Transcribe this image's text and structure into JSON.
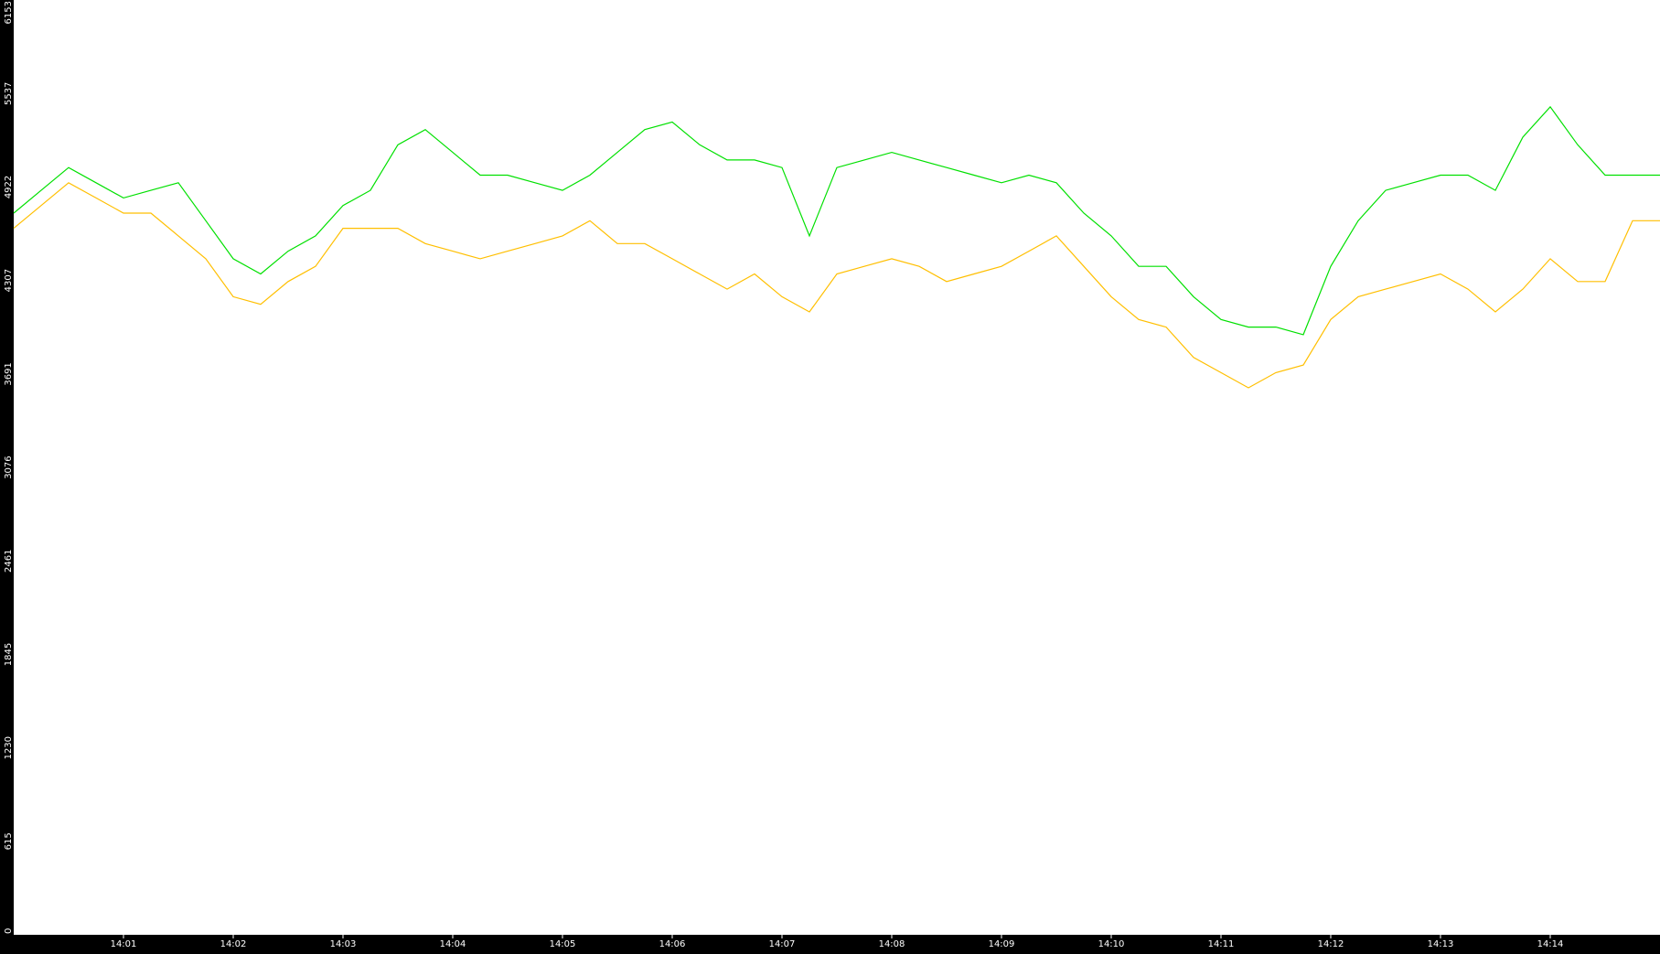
{
  "chart_data": {
    "type": "line",
    "title": "",
    "xlabel": "",
    "ylabel": "",
    "ylim": [
      0,
      6153
    ],
    "y_ticks": [
      "0",
      "615",
      "1230",
      "1845",
      "2461",
      "3076",
      "3691",
      "4307",
      "4922",
      "5537",
      "6153"
    ],
    "x_ticks": [
      "14:01",
      "14:02",
      "14:03",
      "14:04",
      "14:05",
      "14:06",
      "14:07",
      "14:08",
      "14:09",
      "14:10",
      "14:11",
      "14:12",
      "14:13",
      "14:14"
    ],
    "x_range": [
      "14:00:00",
      "14:15:00"
    ],
    "grid": false,
    "legend": "none",
    "colors": {
      "background": "#ffffff",
      "frame": "#000000",
      "tick_text": "#ffffff"
    },
    "series": [
      {
        "color": "#00e000",
        "x": [
          "14:00:00",
          "14:00:15",
          "14:00:30",
          "14:00:45",
          "14:01:00",
          "14:01:15",
          "14:01:30",
          "14:01:45",
          "14:02:00",
          "14:02:15",
          "14:02:30",
          "14:02:45",
          "14:03:00",
          "14:03:15",
          "14:03:30",
          "14:03:45",
          "14:04:00",
          "14:04:15",
          "14:04:30",
          "14:04:45",
          "14:05:00",
          "14:05:15",
          "14:05:30",
          "14:05:45",
          "14:06:00",
          "14:06:15",
          "14:06:30",
          "14:06:45",
          "14:07:00",
          "14:07:15",
          "14:07:30",
          "14:07:45",
          "14:08:00",
          "14:08:15",
          "14:08:30",
          "14:08:45",
          "14:09:00",
          "14:09:15",
          "14:09:30",
          "14:09:45",
          "14:10:00",
          "14:10:15",
          "14:10:30",
          "14:10:45",
          "14:11:00",
          "14:11:15",
          "14:11:30",
          "14:11:45",
          "14:12:00",
          "14:12:15",
          "14:12:30",
          "14:12:45",
          "14:13:00",
          "14:13:15",
          "14:13:30",
          "14:13:45",
          "14:14:00",
          "14:14:15",
          "14:14:30",
          "14:14:45",
          "14:15:00"
        ],
        "values": [
          4750,
          4900,
          5050,
          4950,
          4850,
          4900,
          4950,
          4700,
          4450,
          4350,
          4500,
          4600,
          4800,
          4900,
          5200,
          5300,
          5150,
          5000,
          5000,
          4950,
          4900,
          5000,
          5150,
          5300,
          5350,
          5200,
          5100,
          5100,
          5050,
          4600,
          5050,
          5100,
          5150,
          5100,
          5050,
          5000,
          4950,
          5000,
          4950,
          4750,
          4600,
          4400,
          4400,
          4200,
          4050,
          4000,
          4000,
          3950,
          4400,
          4700,
          4900,
          4950,
          5000,
          5000,
          4900,
          5250,
          5450,
          5200,
          5000,
          5000,
          5000
        ]
      },
      {
        "color": "#ffbf00",
        "x": [
          "14:00:00",
          "14:00:15",
          "14:00:30",
          "14:00:45",
          "14:01:00",
          "14:01:15",
          "14:01:30",
          "14:01:45",
          "14:02:00",
          "14:02:15",
          "14:02:30",
          "14:02:45",
          "14:03:00",
          "14:03:15",
          "14:03:30",
          "14:03:45",
          "14:04:00",
          "14:04:15",
          "14:04:30",
          "14:04:45",
          "14:05:00",
          "14:05:15",
          "14:05:30",
          "14:05:45",
          "14:06:00",
          "14:06:15",
          "14:06:30",
          "14:06:45",
          "14:07:00",
          "14:07:15",
          "14:07:30",
          "14:07:45",
          "14:08:00",
          "14:08:15",
          "14:08:30",
          "14:08:45",
          "14:09:00",
          "14:09:15",
          "14:09:30",
          "14:09:45",
          "14:10:00",
          "14:10:15",
          "14:10:30",
          "14:10:45",
          "14:11:00",
          "14:11:15",
          "14:11:30",
          "14:11:45",
          "14:12:00",
          "14:12:15",
          "14:12:30",
          "14:12:45",
          "14:13:00",
          "14:13:15",
          "14:13:30",
          "14:13:45",
          "14:14:00",
          "14:14:15",
          "14:14:30",
          "14:14:45",
          "14:15:00"
        ],
        "values": [
          4650,
          4800,
          4950,
          4850,
          4750,
          4750,
          4600,
          4450,
          4200,
          4150,
          4300,
          4400,
          4650,
          4650,
          4650,
          4550,
          4500,
          4450,
          4500,
          4550,
          4600,
          4700,
          4550,
          4550,
          4450,
          4350,
          4250,
          4350,
          4200,
          4100,
          4350,
          4400,
          4450,
          4400,
          4300,
          4350,
          4400,
          4500,
          4600,
          4400,
          4200,
          4050,
          4000,
          3800,
          3700,
          3600,
          3700,
          3750,
          4050,
          4200,
          4250,
          4300,
          4350,
          4250,
          4100,
          4250,
          4450,
          4300,
          4300,
          4700,
          4700
        ]
      }
    ]
  }
}
